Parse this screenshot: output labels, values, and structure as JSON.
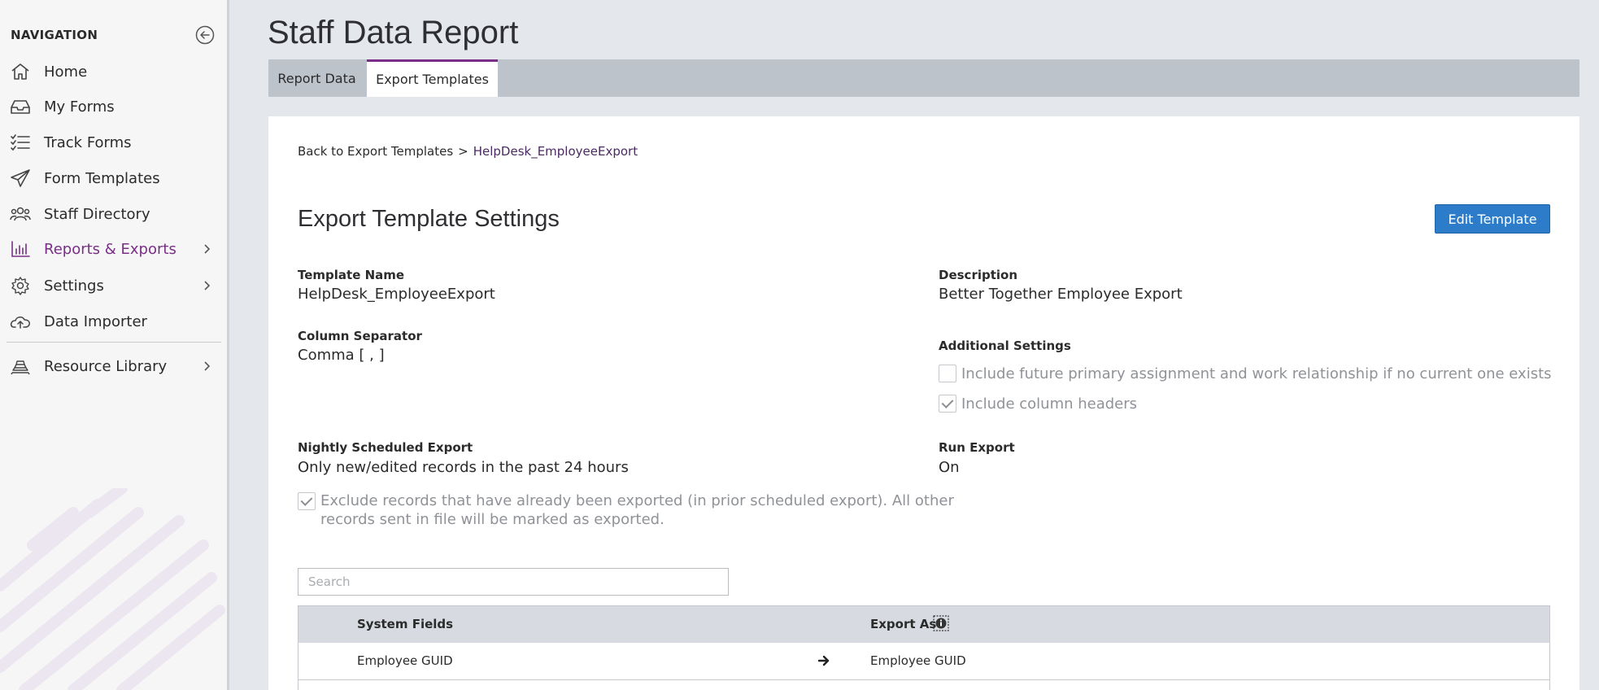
{
  "sidebar": {
    "header": "NAVIGATION",
    "items": [
      {
        "label": "Home",
        "icon": "home-icon"
      },
      {
        "label": "My Forms",
        "icon": "inbox-icon"
      },
      {
        "label": "Track Forms",
        "icon": "checklist-icon"
      },
      {
        "label": "Form Templates",
        "icon": "paper-plane-icon"
      },
      {
        "label": "Staff Directory",
        "icon": "people-icon"
      },
      {
        "label": "Reports & Exports",
        "icon": "bar-chart-icon",
        "active": true
      },
      {
        "label": "Settings",
        "icon": "gear-icon"
      },
      {
        "label": "Data Importer",
        "icon": "cloud-upload-icon"
      },
      {
        "label": "Resource Library",
        "icon": "library-icon"
      }
    ]
  },
  "page": {
    "title": "Staff Data Report"
  },
  "tabs": [
    {
      "label": "Report Data"
    },
    {
      "label": "Export Templates",
      "active": true
    }
  ],
  "breadcrumb": {
    "back": "Back to Export Templates",
    "separator": ">",
    "current": "HelpDesk_EmployeeExport"
  },
  "settings": {
    "title": "Export Template Settings",
    "edit_button": "Edit Template",
    "template_name_label": "Template Name",
    "template_name_value": "HelpDesk_EmployeeExport",
    "description_label": "Description",
    "description_value": "Better Together Employee Export",
    "column_separator_label": "Column Separator",
    "column_separator_value": "Comma [ , ]",
    "additional_settings_label": "Additional Settings",
    "include_future_label": "Include future primary assignment and work relationship if no current one exists",
    "include_future_checked": false,
    "include_headers_label": "Include column headers",
    "include_headers_checked": true,
    "nightly_label": "Nightly Scheduled Export",
    "nightly_value": "Only new/edited records in the past 24 hours",
    "exclude_label_line1": "Exclude records that have already been exported (in prior scheduled export). All other",
    "exclude_label_line2": "records sent in file will be marked as exported.",
    "exclude_checked": true,
    "run_export_label": "Run Export",
    "run_export_value": "On"
  },
  "search": {
    "placeholder": "Search"
  },
  "table": {
    "headers": {
      "system_fields": "System Fields",
      "export_as": "Export As"
    },
    "rows": [
      {
        "system_field": "Employee GUID",
        "export_as": "Employee GUID"
      }
    ]
  },
  "colors": {
    "accent": "#7a2e86",
    "primary_button": "#2d7cc9"
  }
}
